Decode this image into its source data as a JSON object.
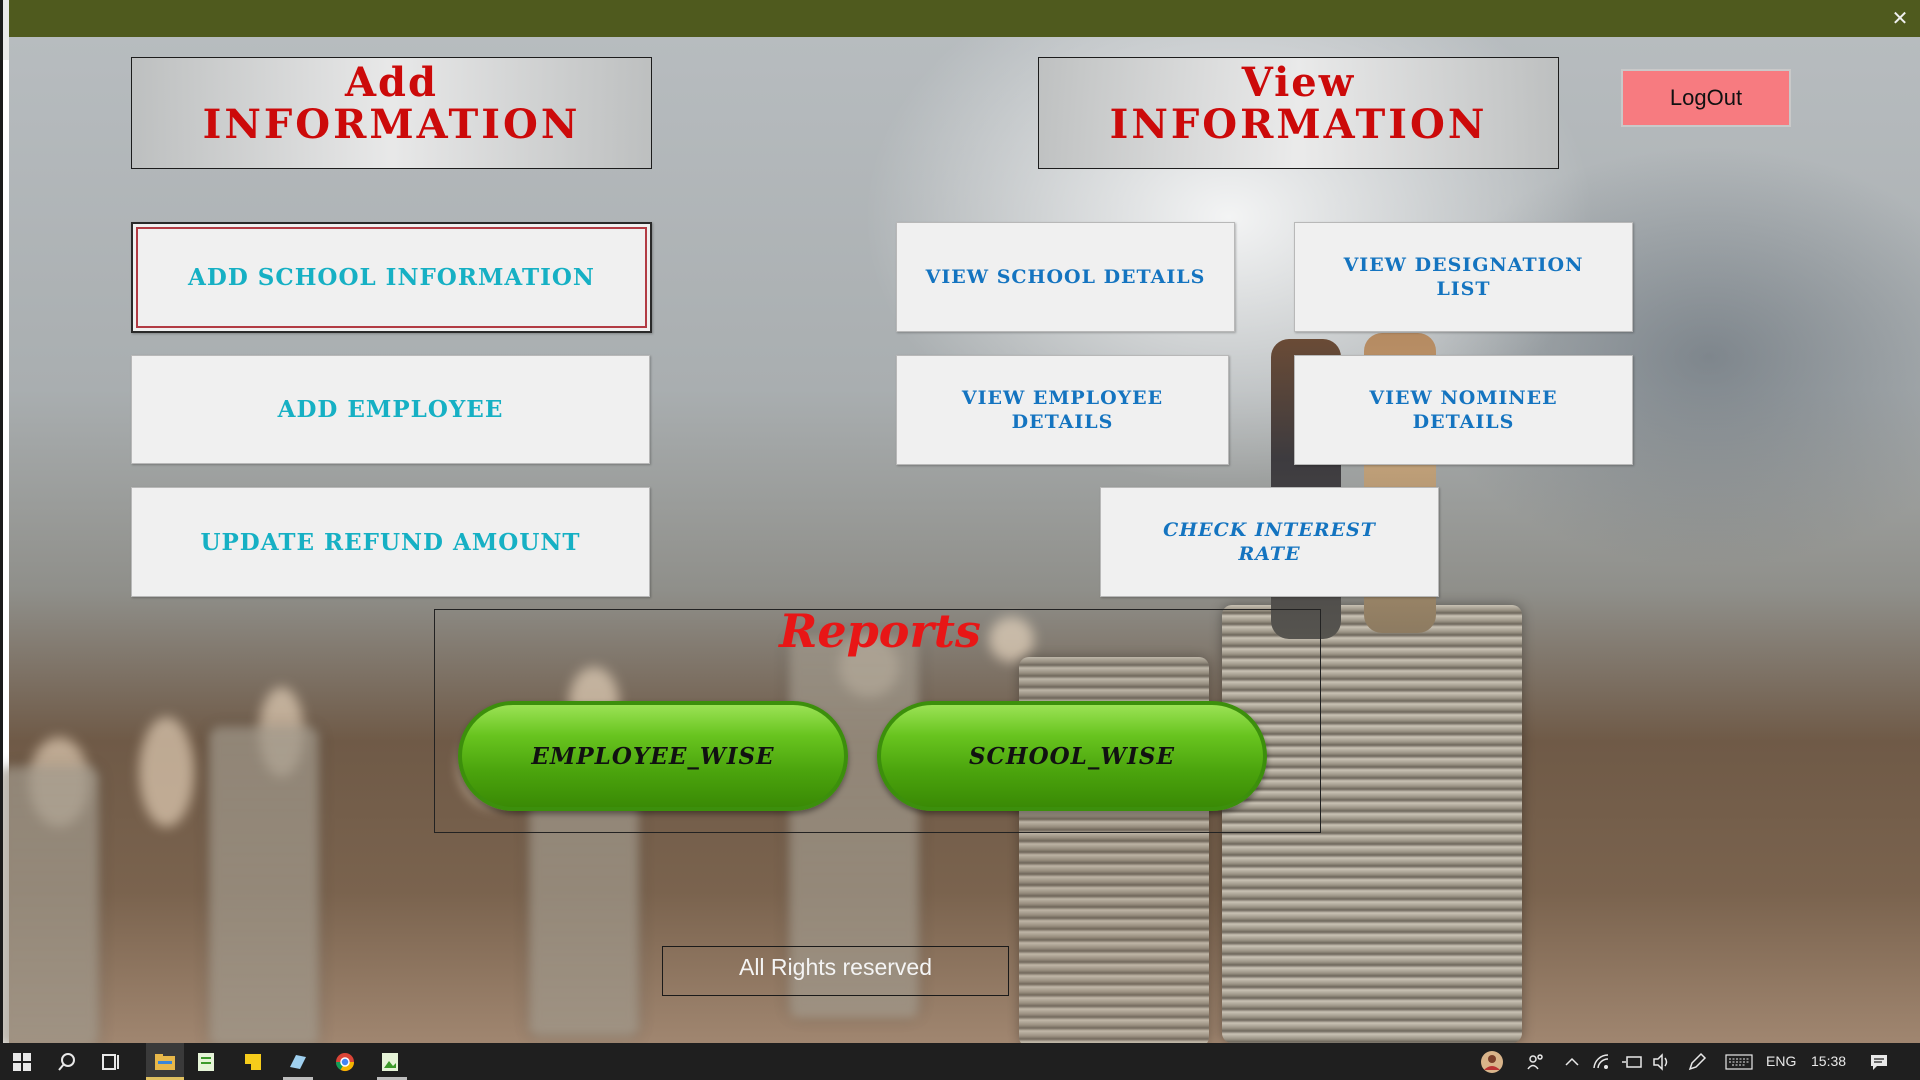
{
  "window": {
    "close_glyph": "✕"
  },
  "headers": {
    "add": {
      "line1": "Add",
      "line2": "INFORMATION"
    },
    "view": {
      "line1": "View",
      "line2": "INFORMATION"
    }
  },
  "logout_label": "LogOut",
  "add_buttons": [
    {
      "label": "ADD SCHOOL INFORMATION"
    },
    {
      "label": "ADD EMPLOYEE"
    },
    {
      "label": "UPDATE REFUND AMOUNT"
    }
  ],
  "view_buttons": {
    "school_details": "VIEW SCHOOL DETAILS",
    "designation_list": "VIEW DESIGNATION LIST",
    "employee_details": "VIEW EMPLOYEE DETAILS",
    "nominee_details": "VIEW NOMINEE DETAILS",
    "interest_rate": "CHECK INTEREST RATE"
  },
  "reports": {
    "title": "Reports",
    "employee_wise": "EMPLOYEE_WISE",
    "school_wise": "SCHOOL_WISE"
  },
  "footer": "All Rights reserved",
  "colors": {
    "title_bar": "#4f5a1e",
    "header_text": "#cc0a0a",
    "add_text": "#16b0c4",
    "view_text": "#1474c0",
    "logout_bg": "#f77b80",
    "report_pill": "#4ba40d",
    "reports_title": "#e81616"
  },
  "taskbar": {
    "icons": [
      "windows-start-icon",
      "search-icon",
      "task-view-icon",
      "file-explorer-icon",
      "notepad-icon",
      "sticky-notes-icon",
      "app-icon",
      "chrome-icon",
      "image-viewer-icon"
    ],
    "tray": {
      "language": "ENG",
      "time": "15:38"
    }
  }
}
